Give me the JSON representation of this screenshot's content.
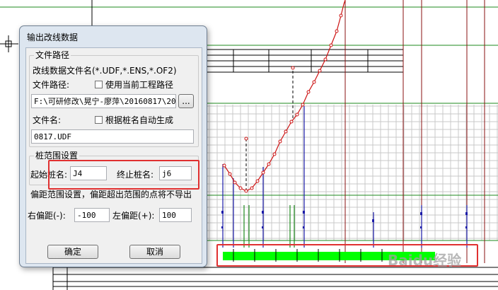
{
  "dialog": {
    "title": "输出改线数据",
    "file_group": {
      "label": "文件路径",
      "format_label": "改线数据文件名(*.UDF,*.ENS,*.OF2)",
      "path_label": "文件路径:",
      "use_project_path_label": "使用当前工程路径",
      "use_project_path_checked": false,
      "path_value": "F:\\可研修改\\晃宁-廖萍\\20160817\\20",
      "browse_label": "...",
      "filename_label": "文件名:",
      "auto_name_label": "根据桩名自动生成",
      "auto_name_checked": false,
      "filename_value": "0817.UDF"
    },
    "stake_group": {
      "label": "桩范围设置",
      "start_label": "起始桩名:",
      "start_value": "J4",
      "end_label": "终止桩名:",
      "end_value": "j6"
    },
    "offset": {
      "note": "偏距范围设置，偏距超出范围的点将不导出",
      "right_label": "右偏距(-):",
      "right_value": "-100",
      "left_label": "左偏距(+):",
      "left_value": "100"
    },
    "ok_label": "确定",
    "cancel_label": "取消"
  },
  "watermark": "Baidu经验",
  "colors": {
    "profile_line": "#cc1111",
    "grid": "#c8c8c8",
    "vertical_lines": "#1a1aa8",
    "green_lines": "#1e8a1e",
    "green_bar": "#00ff00",
    "highlight": "#e03030"
  }
}
